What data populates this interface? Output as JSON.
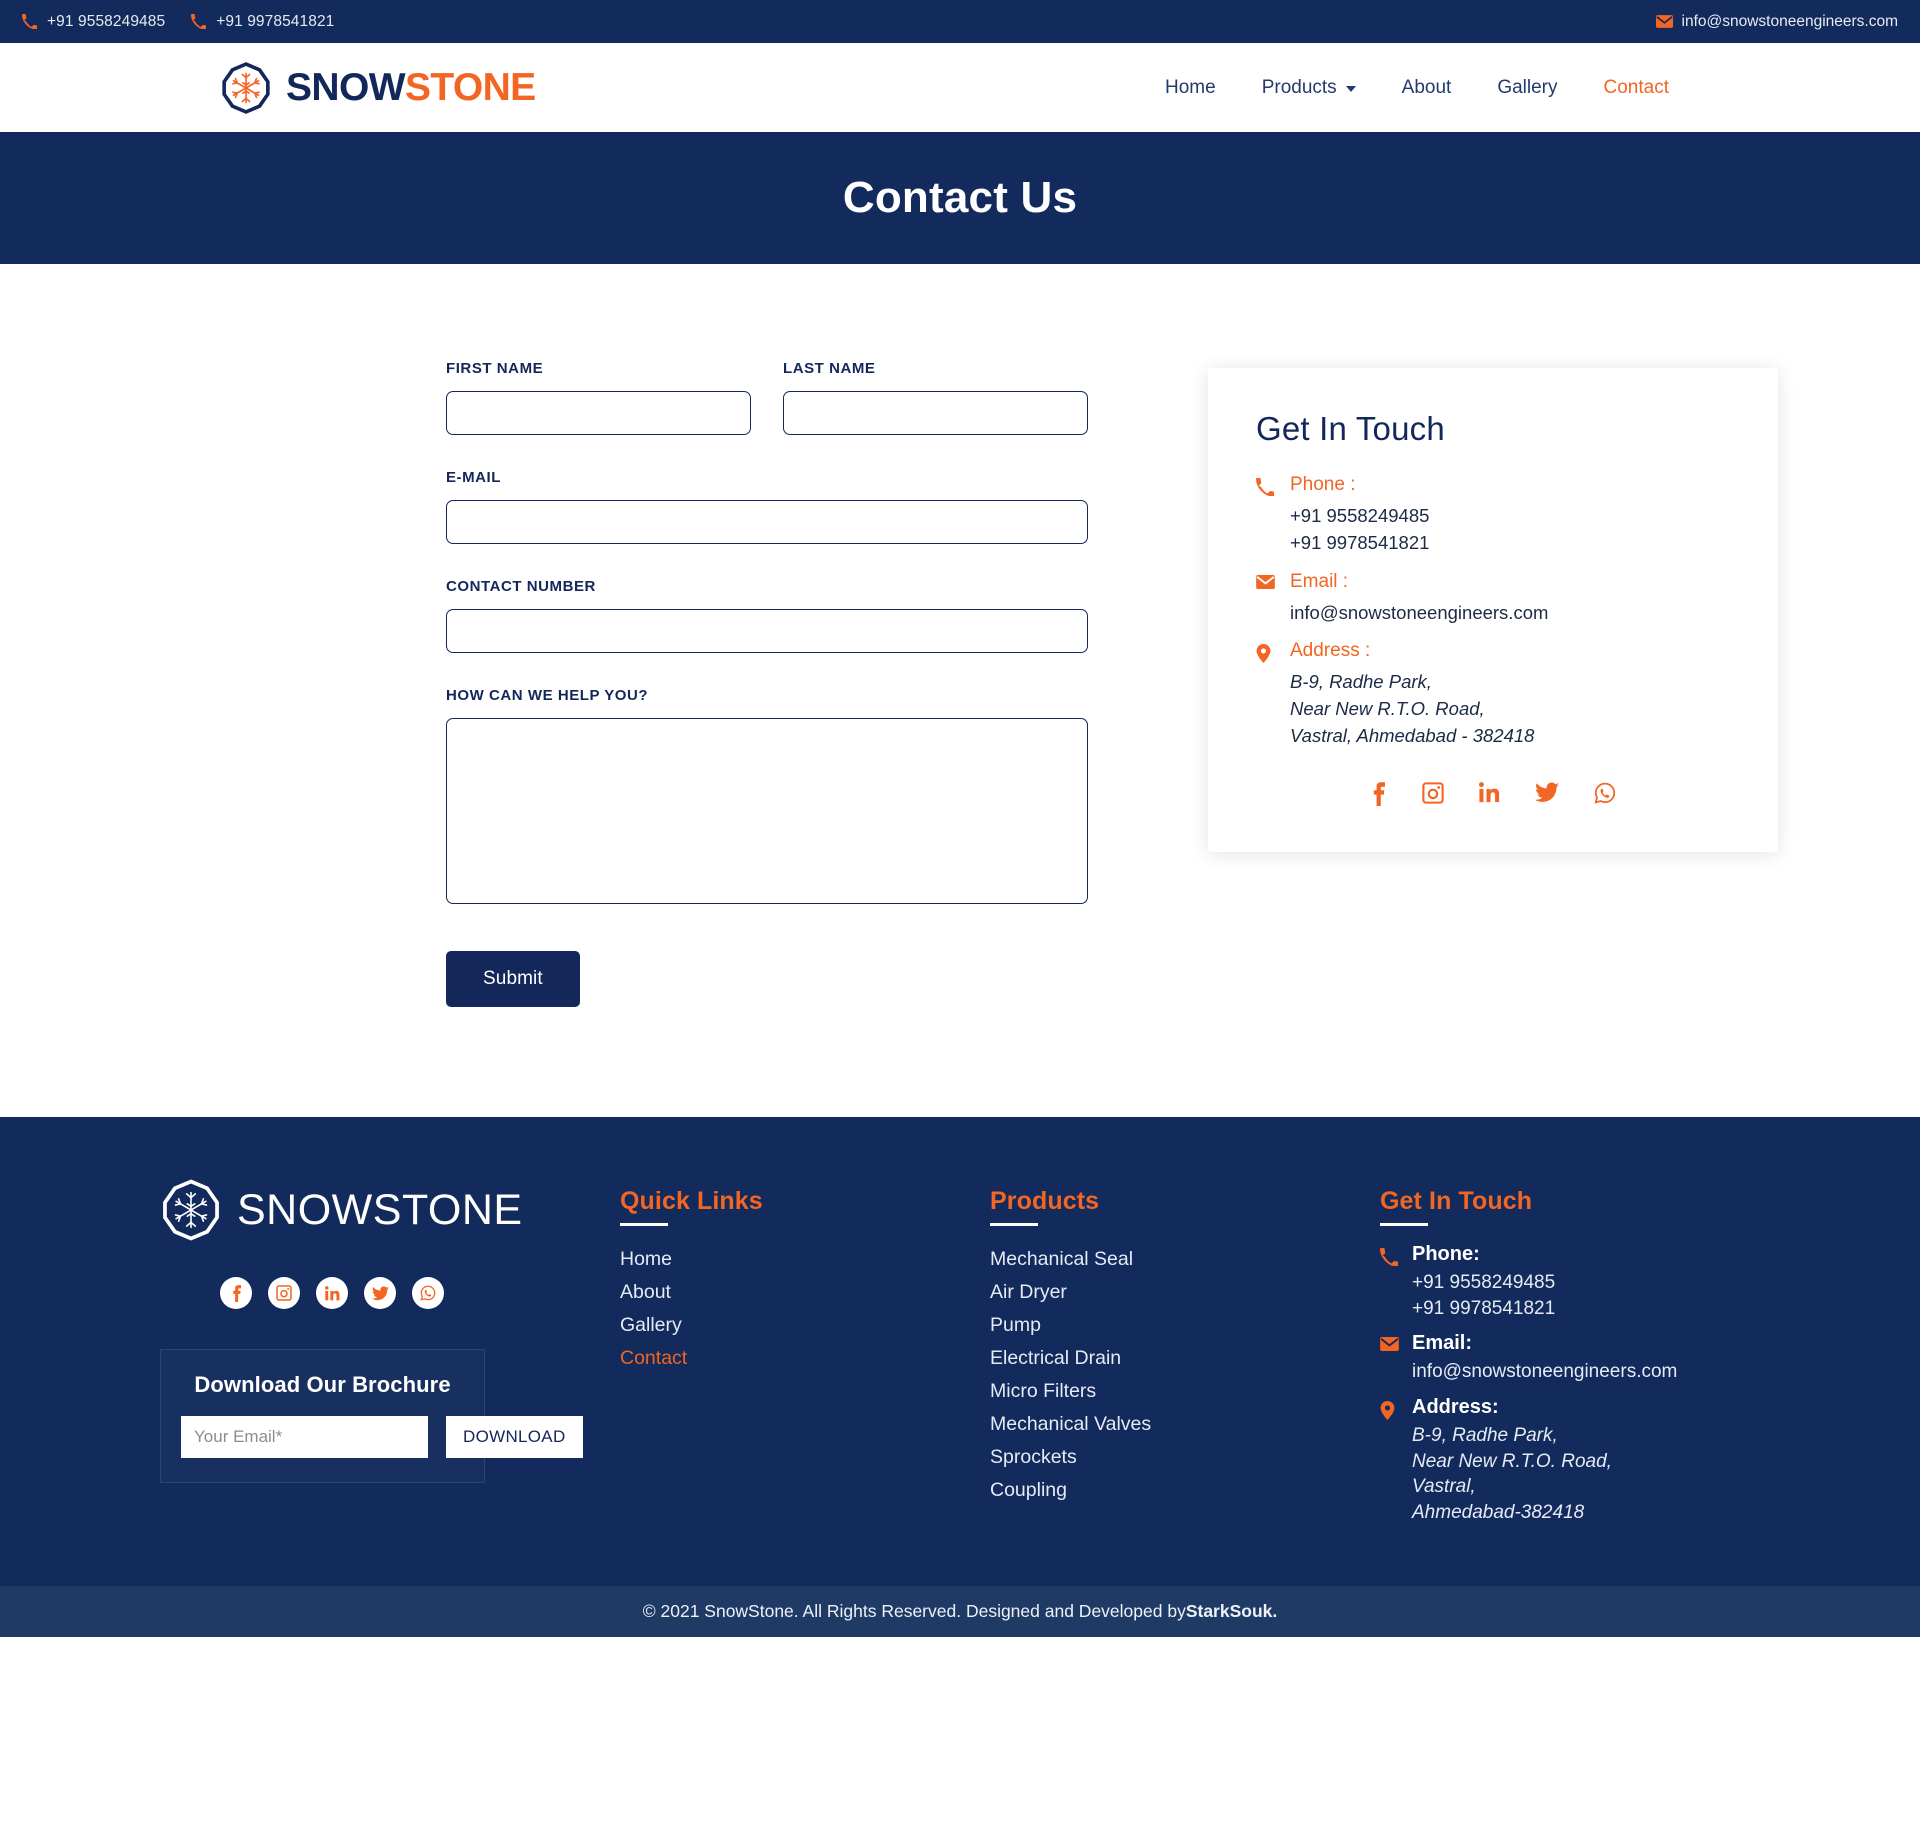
{
  "topbar": {
    "phone1": "+91 9558249485",
    "phone2": "+91 9978541821",
    "email": "info@snowstoneengineers.com"
  },
  "header": {
    "brand_part1": "SNOW",
    "brand_part2": "STONE",
    "nav": [
      {
        "label": "Home",
        "active": false,
        "caret": false
      },
      {
        "label": "Products",
        "active": false,
        "caret": true
      },
      {
        "label": "About",
        "active": false,
        "caret": false
      },
      {
        "label": "Gallery",
        "active": false,
        "caret": false
      },
      {
        "label": "Contact",
        "active": true,
        "caret": false
      }
    ]
  },
  "hero": {
    "title": "Contact Us"
  },
  "form": {
    "first_name_label": "FIRST NAME",
    "first_name_value": "",
    "last_name_label": "LAST NAME",
    "last_name_value": "",
    "email_label": "E-MAIL",
    "email_value": "",
    "contact_label": "CONTACT NUMBER",
    "contact_value": "",
    "message_label": "HOW CAN WE HELP YOU?",
    "message_value": "",
    "submit_label": "Submit"
  },
  "get_in_touch": {
    "title": "Get In Touch",
    "phone_title": "Phone :",
    "phone1": "+91 9558249485",
    "phone2": "+91 9978541821",
    "email_title": "Email :",
    "email": "info@snowstoneengineers.com",
    "address_title": "Address :",
    "address1": "B-9, Radhe Park,",
    "address2": "Near New R.T.O. Road,",
    "address3": "Vastral, Ahmedabad - 382418",
    "social": [
      "facebook-icon",
      "instagram-icon",
      "linkedin-icon",
      "twitter-icon",
      "whatsapp-icon"
    ]
  },
  "footer": {
    "brand": "SNOWSTONE",
    "social": [
      "facebook-icon",
      "instagram-icon",
      "linkedin-icon",
      "twitter-icon",
      "whatsapp-icon"
    ],
    "brochure": {
      "title": "Download Our Brochure",
      "email_placeholder": "Your Email*",
      "email_value": "",
      "button_label": "DOWNLOAD"
    },
    "quick_links": {
      "heading": "Quick Links",
      "items": [
        {
          "label": "Home",
          "active": false
        },
        {
          "label": "About",
          "active": false
        },
        {
          "label": "Gallery",
          "active": false
        },
        {
          "label": "Contact",
          "active": true
        }
      ]
    },
    "products": {
      "heading": "Products",
      "items": [
        {
          "label": "Mechanical Seal"
        },
        {
          "label": "Air Dryer"
        },
        {
          "label": "Pump"
        },
        {
          "label": "Electrical Drain"
        },
        {
          "label": "Micro Filters"
        },
        {
          "label": "Mechanical Valves"
        },
        {
          "label": "Sprockets"
        },
        {
          "label": "Coupling"
        }
      ]
    },
    "get_in_touch": {
      "heading": "Get In Touch",
      "phone_title": "Phone:",
      "phone1": "+91 9558249485",
      "phone2": "+91 9978541821",
      "email_title": "Email:",
      "email": "info@snowstoneengineers.com",
      "address_title": "Address:",
      "address1": "B-9, Radhe Park,",
      "address2": "Near New R.T.O. Road,",
      "address3": "Vastral,",
      "address4": "Ahmedabad-382418"
    }
  },
  "copyright": {
    "text": "© 2021 SnowStone. All Rights Reserved. Designed and Developed by ",
    "credit": "StarkSouk."
  },
  "colors": {
    "navy": "#122a5c",
    "navy_dark": "#14275a",
    "orange": "#f26522",
    "copyright_bar": "#203a66"
  }
}
